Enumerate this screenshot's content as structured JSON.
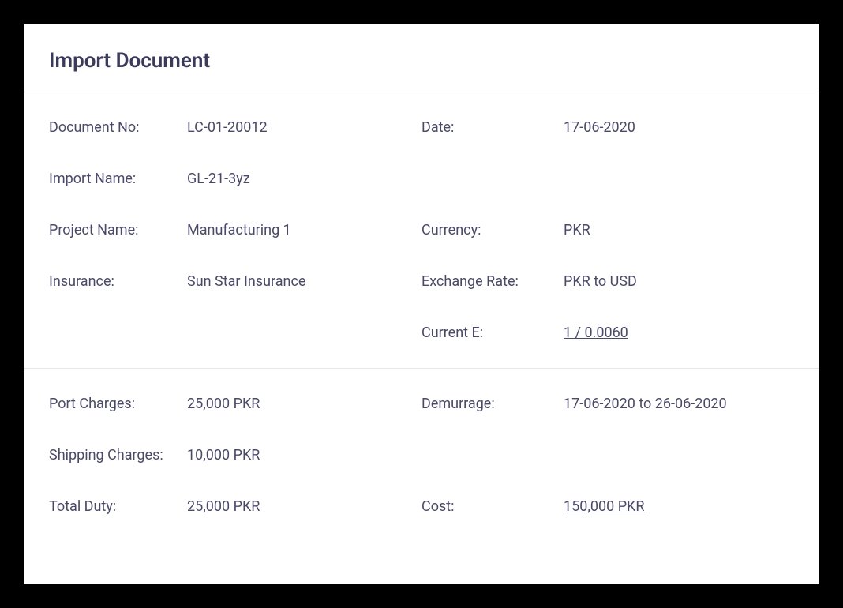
{
  "title": "Import Document",
  "section1": {
    "document_no": {
      "label": "Document No:",
      "value": "LC-01-20012"
    },
    "date": {
      "label": "Date:",
      "value": "17-06-2020"
    },
    "import_name": {
      "label": "Import Name:",
      "value": "GL-21-3yz"
    },
    "project_name": {
      "label": "Project Name:",
      "value": "Manufacturing 1"
    },
    "currency": {
      "label": "Currency:",
      "value": "PKR"
    },
    "insurance": {
      "label": "Insurance:",
      "value": "Sun Star Insurance"
    },
    "exchange_rate": {
      "label": "Exchange Rate:",
      "value": "PKR to USD"
    },
    "current_e": {
      "label": "Current E:",
      "value": "1 / 0.0060"
    }
  },
  "section2": {
    "port_charges": {
      "label": "Port Charges:",
      "value": "25,000 PKR"
    },
    "demurrage": {
      "label": "Demurrage:",
      "value": "17-06-2020 to 26-06-2020"
    },
    "shipping_charges": {
      "label": "Shipping Charges:",
      "value": "10,000 PKR"
    },
    "total_duty": {
      "label": "Total Duty:",
      "value": "25,000 PKR"
    },
    "cost": {
      "label": "Cost:",
      "value": "150,000 PKR"
    }
  }
}
